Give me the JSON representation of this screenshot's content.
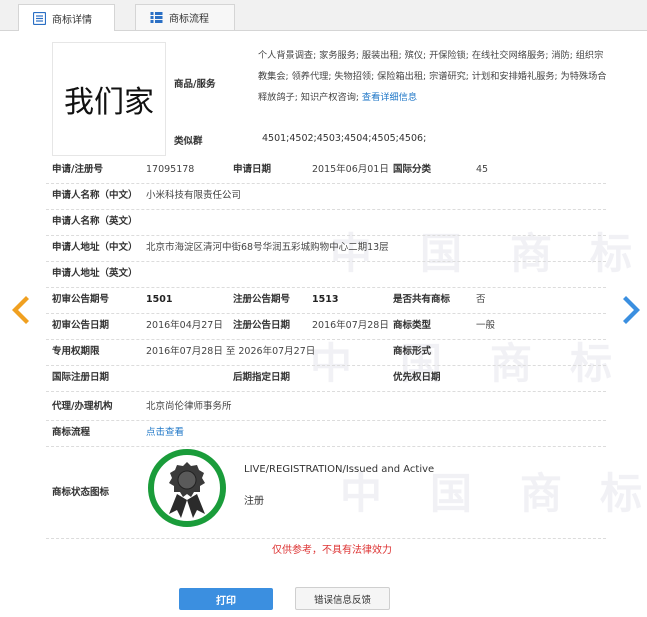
{
  "tabs": [
    {
      "label": "商标详情",
      "active": true
    },
    {
      "label": "商标流程",
      "active": false
    }
  ],
  "trademark": {
    "logo_text": "我们家",
    "goods_label": "商品/服务",
    "goods_text": "个人背景调查; 家务服务; 服装出租; 殡仪; 开保险锁; 在线社交网络服务; 消防; 组织宗教集会; 领养代理; 失物招领; 保险箱出租; 宗谱研究; 计划和安排婚礼服务; 为特殊场合释放鸽子; 知识产权咨询;",
    "goods_more": "查看详细信息",
    "similar_label": "类似群",
    "similar_value": "4501;4502;4503;4504;4505;4506;"
  },
  "fields": {
    "reg_no_label": "申请/注册号",
    "reg_no": "17095178",
    "apply_date_label": "申请日期",
    "apply_date": "2015年06月01日",
    "intl_class_label": "国际分类",
    "intl_class": "45",
    "applicant_cn_label": "申请人名称（中文）",
    "applicant_cn": "小米科技有限责任公司",
    "applicant_en_label": "申请人名称（英文）",
    "applicant_en": "",
    "address_cn_label": "申请人地址（中文）",
    "address_cn": "北京市海淀区清河中街68号华润五彩城购物中心二期13层",
    "address_en_label": "申请人地址（英文）",
    "address_en": "",
    "prelim_no_label": "初审公告期号",
    "prelim_no": "1501",
    "reg_pub_no_label": "注册公告期号",
    "reg_pub_no": "1513",
    "shared_label": "是否共有商标",
    "shared": "否",
    "prelim_date_label": "初审公告日期",
    "prelim_date": "2016年04月27日",
    "reg_pub_date_label": "注册公告日期",
    "reg_pub_date": "2016年07月28日",
    "tm_type_label": "商标类型",
    "tm_type": "一般",
    "exclusive_label": "专用权期限",
    "exclusive": "2016年07月28日 至 2026年07月27日",
    "tm_form_label": "商标形式",
    "tm_form": "",
    "intl_reg_date_label": "国际注册日期",
    "intl_reg_date": "",
    "later_date_label": "后期指定日期",
    "later_date": "",
    "priority_date_label": "优先权日期",
    "priority_date": "",
    "agent_label": "代理/办理机构",
    "agent": "北京尚伦律师事务所",
    "flow_label": "商标流程",
    "flow_link": "点击查看",
    "status_icon_label": "商标状态图标",
    "status_en": "LIVE/REGISTRATION/Issued and Active",
    "status_cn": "注册"
  },
  "note": "仅供参考，不具有法律效力",
  "buttons": {
    "print": "打印",
    "feedback": "错误信息反馈"
  },
  "watermark_text": [
    "中",
    "国",
    "商",
    "标"
  ],
  "colors": {
    "accent": "#3b8fe0",
    "link": "#1f77c7",
    "arrow": "#f0a020",
    "arrow_right": "#3b8fe0",
    "seal_ring": "#1a9c3a",
    "note": "#dd3333"
  }
}
